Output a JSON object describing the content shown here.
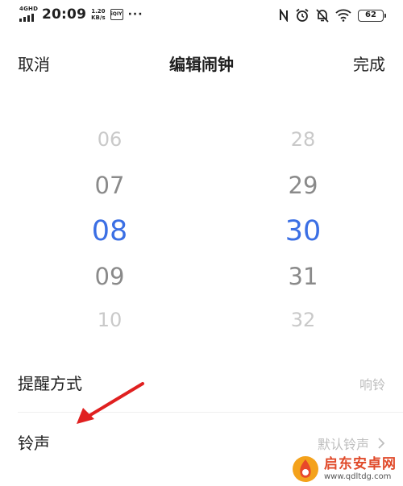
{
  "status_bar": {
    "network": "4GHD",
    "time": "20:09",
    "speed_value": "1.20",
    "speed_unit": "KB/s",
    "app_badge": "iQIY",
    "more": "···",
    "battery": "62"
  },
  "header": {
    "cancel": "取消",
    "title": "编辑闹钟",
    "done": "完成"
  },
  "picker": {
    "hours": [
      "06",
      "07",
      "08",
      "09",
      "10"
    ],
    "minutes": [
      "28",
      "29",
      "30",
      "31",
      "32"
    ],
    "selected_color": "#3b6fe4"
  },
  "settings": {
    "reminder_label": "提醒方式",
    "reminder_value": "响铃",
    "ringtone_label": "铃声",
    "ringtone_value": "默认铃声"
  },
  "watermark": {
    "name": "启东安卓网",
    "url": "www.qdltdg.com"
  }
}
